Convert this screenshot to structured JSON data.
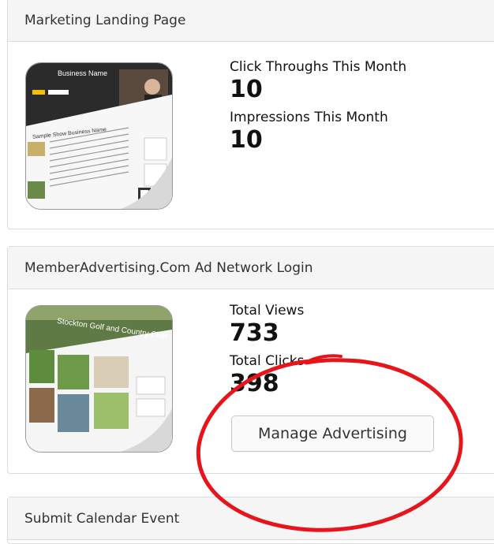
{
  "marketing": {
    "title": "Marketing Landing Page",
    "thumb_caption": "Business Name",
    "thumb_subtitle": "Sample Show Business Name",
    "stats": [
      {
        "label": "Click Throughs This Month",
        "value": "10"
      },
      {
        "label": "Impressions This Month",
        "value": "10"
      }
    ]
  },
  "ad_network": {
    "title": "MemberAdvertising.Com Ad Network Login",
    "thumb_caption": "Stockton Golf and Country Club",
    "stats": [
      {
        "label": "Total Views",
        "value": "733"
      },
      {
        "label": "Total Clicks",
        "value": "398"
      }
    ],
    "button_label": "Manage Advertising"
  },
  "calendar": {
    "title": "Submit Calendar Event"
  },
  "colors": {
    "annotation_circle": "#e8141b",
    "panel_header_bg": "#f5f5f5"
  }
}
